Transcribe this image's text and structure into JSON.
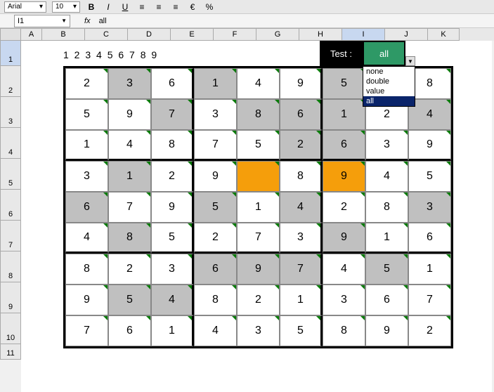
{
  "toolbar": {
    "font": "Arial",
    "size": "10"
  },
  "formula": {
    "cell_ref": "I1",
    "fx": "fx",
    "value": "all"
  },
  "columns": [
    "A",
    "B",
    "C",
    "D",
    "E",
    "F",
    "G",
    "H",
    "I",
    "J",
    "K"
  ],
  "rows": [
    "1",
    "2",
    "3",
    "4",
    "5",
    "6",
    "7",
    "8",
    "9",
    "10",
    "11"
  ],
  "row1_text": "1 2 3 4 5 6 7 8 9",
  "test_label": "Test :",
  "all_label": "all",
  "dropdown": {
    "options": [
      "none",
      "double",
      "value",
      "all"
    ],
    "selected": "all"
  },
  "sudoku": [
    [
      {
        "v": "2"
      },
      {
        "v": "3",
        "s": 1
      },
      {
        "v": "6"
      },
      {
        "v": "1",
        "s": 1
      },
      {
        "v": "4"
      },
      {
        "v": "9"
      },
      {
        "v": "5",
        "s": 1
      },
      {
        "v": ""
      },
      {
        "v": "8"
      }
    ],
    [
      {
        "v": "5"
      },
      {
        "v": "9"
      },
      {
        "v": "7",
        "s": 1
      },
      {
        "v": "3"
      },
      {
        "v": "8",
        "s": 1
      },
      {
        "v": "6",
        "s": 1
      },
      {
        "v": "1",
        "s": 1
      },
      {
        "v": "2"
      },
      {
        "v": "4",
        "s": 1
      }
    ],
    [
      {
        "v": "1"
      },
      {
        "v": "4"
      },
      {
        "v": "8"
      },
      {
        "v": "7"
      },
      {
        "v": "5"
      },
      {
        "v": "2",
        "s": 1
      },
      {
        "v": "6",
        "s": 1
      },
      {
        "v": "3"
      },
      {
        "v": "9"
      }
    ],
    [
      {
        "v": "3"
      },
      {
        "v": "1",
        "s": 1
      },
      {
        "v": "2"
      },
      {
        "v": "9"
      },
      {
        "v": "",
        "o": 1
      },
      {
        "v": "8"
      },
      {
        "v": "9",
        "o": 1
      },
      {
        "v": "4"
      },
      {
        "v": "5"
      }
    ],
    [
      {
        "v": "6",
        "s": 1
      },
      {
        "v": "7"
      },
      {
        "v": "9"
      },
      {
        "v": "5",
        "s": 1
      },
      {
        "v": "1"
      },
      {
        "v": "4",
        "s": 1
      },
      {
        "v": "2"
      },
      {
        "v": "8"
      },
      {
        "v": "3",
        "s": 1
      }
    ],
    [
      {
        "v": "4"
      },
      {
        "v": "8",
        "s": 1
      },
      {
        "v": "5"
      },
      {
        "v": "2"
      },
      {
        "v": "7"
      },
      {
        "v": "3"
      },
      {
        "v": "9",
        "s": 1
      },
      {
        "v": "1"
      },
      {
        "v": "6"
      }
    ],
    [
      {
        "v": "8"
      },
      {
        "v": "2"
      },
      {
        "v": "3"
      },
      {
        "v": "6",
        "s": 1
      },
      {
        "v": "9",
        "s": 1
      },
      {
        "v": "7",
        "s": 1
      },
      {
        "v": "4"
      },
      {
        "v": "5",
        "s": 1
      },
      {
        "v": "1"
      }
    ],
    [
      {
        "v": "9"
      },
      {
        "v": "5",
        "s": 1
      },
      {
        "v": "4",
        "s": 1
      },
      {
        "v": "8"
      },
      {
        "v": "2"
      },
      {
        "v": "1"
      },
      {
        "v": "3"
      },
      {
        "v": "6"
      },
      {
        "v": "7"
      }
    ],
    [
      {
        "v": "7"
      },
      {
        "v": "6"
      },
      {
        "v": "1"
      },
      {
        "v": "4"
      },
      {
        "v": "3"
      },
      {
        "v": "5"
      },
      {
        "v": "8"
      },
      {
        "v": "9"
      },
      {
        "v": "2"
      }
    ]
  ]
}
